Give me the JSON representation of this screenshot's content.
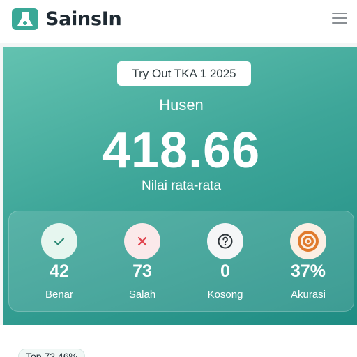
{
  "header": {
    "brand": "SainsIn",
    "logo_icon": "flask-icon",
    "menu_icon": "hamburger-menu-icon"
  },
  "result": {
    "event": "Try Out TKA 1 2025",
    "name": "Husen",
    "score": "418.66",
    "score_label": "Nilai rata-rata"
  },
  "stats": [
    {
      "icon": "check-icon",
      "value": "42",
      "label": "Benar",
      "circle_color": "#e6f6ef",
      "icon_color": "#2f8b77"
    },
    {
      "icon": "x-icon",
      "value": "73",
      "label": "Salah",
      "circle_color": "#fbe9ea",
      "icon_color": "#e0404a"
    },
    {
      "icon": "question-icon",
      "value": "0",
      "label": "Kosong",
      "circle_color": "#f5f6f7",
      "icon_color": "#2c3338"
    },
    {
      "icon": "target-icon",
      "value": "37%",
      "label": "Akurasi",
      "circle_color": "#fbefe4",
      "icon_color": "#e07a2c"
    }
  ],
  "rank": {
    "label": "Top 72.46%"
  },
  "colors": {
    "brand_teal": "#3aa897",
    "hero_start": "#63c2b0",
    "hero_end": "#1f8c83"
  }
}
